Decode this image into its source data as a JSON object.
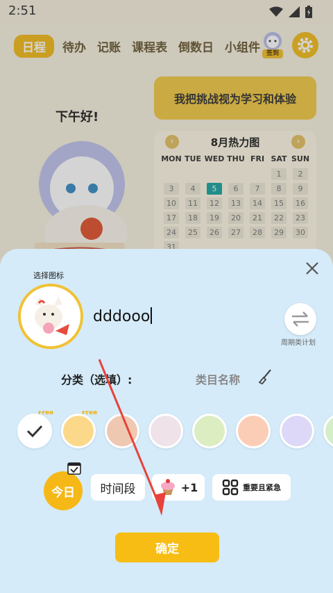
{
  "status_bar": {
    "time": "2:51"
  },
  "background": {
    "tabs": [
      "日程",
      "待办",
      "记账",
      "课程表",
      "倒数日",
      "小组件"
    ],
    "signin_label": "签到",
    "greeting": "下午好!",
    "challenge_text": "我把挑战视为学习和体验",
    "heatmap": {
      "title": "8月热力图",
      "weekdays": [
        "MON",
        "TUE",
        "WED",
        "THU",
        "FRI",
        "SAT",
        "SUN"
      ],
      "weeks": [
        [
          "",
          "",
          "",
          "",
          "",
          "1",
          "2"
        ],
        [
          "3",
          "4",
          "5",
          "6",
          "7",
          "8",
          "9"
        ],
        [
          "10",
          "11",
          "12",
          "13",
          "14",
          "15",
          "16"
        ],
        [
          "17",
          "18",
          "19",
          "20",
          "21",
          "22",
          "23"
        ],
        [
          "24",
          "25",
          "26",
          "27",
          "28",
          "29",
          "30"
        ],
        [
          "31",
          "",
          "",
          "",
          "",
          "",
          ""
        ]
      ],
      "highlight_day": "5"
    }
  },
  "sheet": {
    "pick_icon_label": "选择图标",
    "task_name_value": "dddooo",
    "cycle_label": "周期类计划",
    "category_label": "分类（选填）:",
    "category_placeholder": "类目名称",
    "colors": [
      {
        "hex": "#ffffff",
        "free": "Free",
        "selected": true
      },
      {
        "hex": "#fcd98a",
        "free": "Free",
        "selected": false
      },
      {
        "hex": "#efc8b1",
        "free": "",
        "selected": false
      },
      {
        "hex": "#efe2e8",
        "free": "",
        "selected": false
      },
      {
        "hex": "#dcedc2",
        "free": "",
        "selected": false
      },
      {
        "hex": "#fccdb6",
        "free": "",
        "selected": false
      },
      {
        "hex": "#ddd8f7",
        "free": "",
        "selected": false
      },
      {
        "hex": "#d4efc8",
        "free": "",
        "selected": false
      }
    ],
    "today_label": "今日",
    "time_label": "时间段",
    "plus_label": "+1",
    "priority_label": "重要且紧急",
    "confirm_label": "确定"
  },
  "accent_color": "#f6b817"
}
